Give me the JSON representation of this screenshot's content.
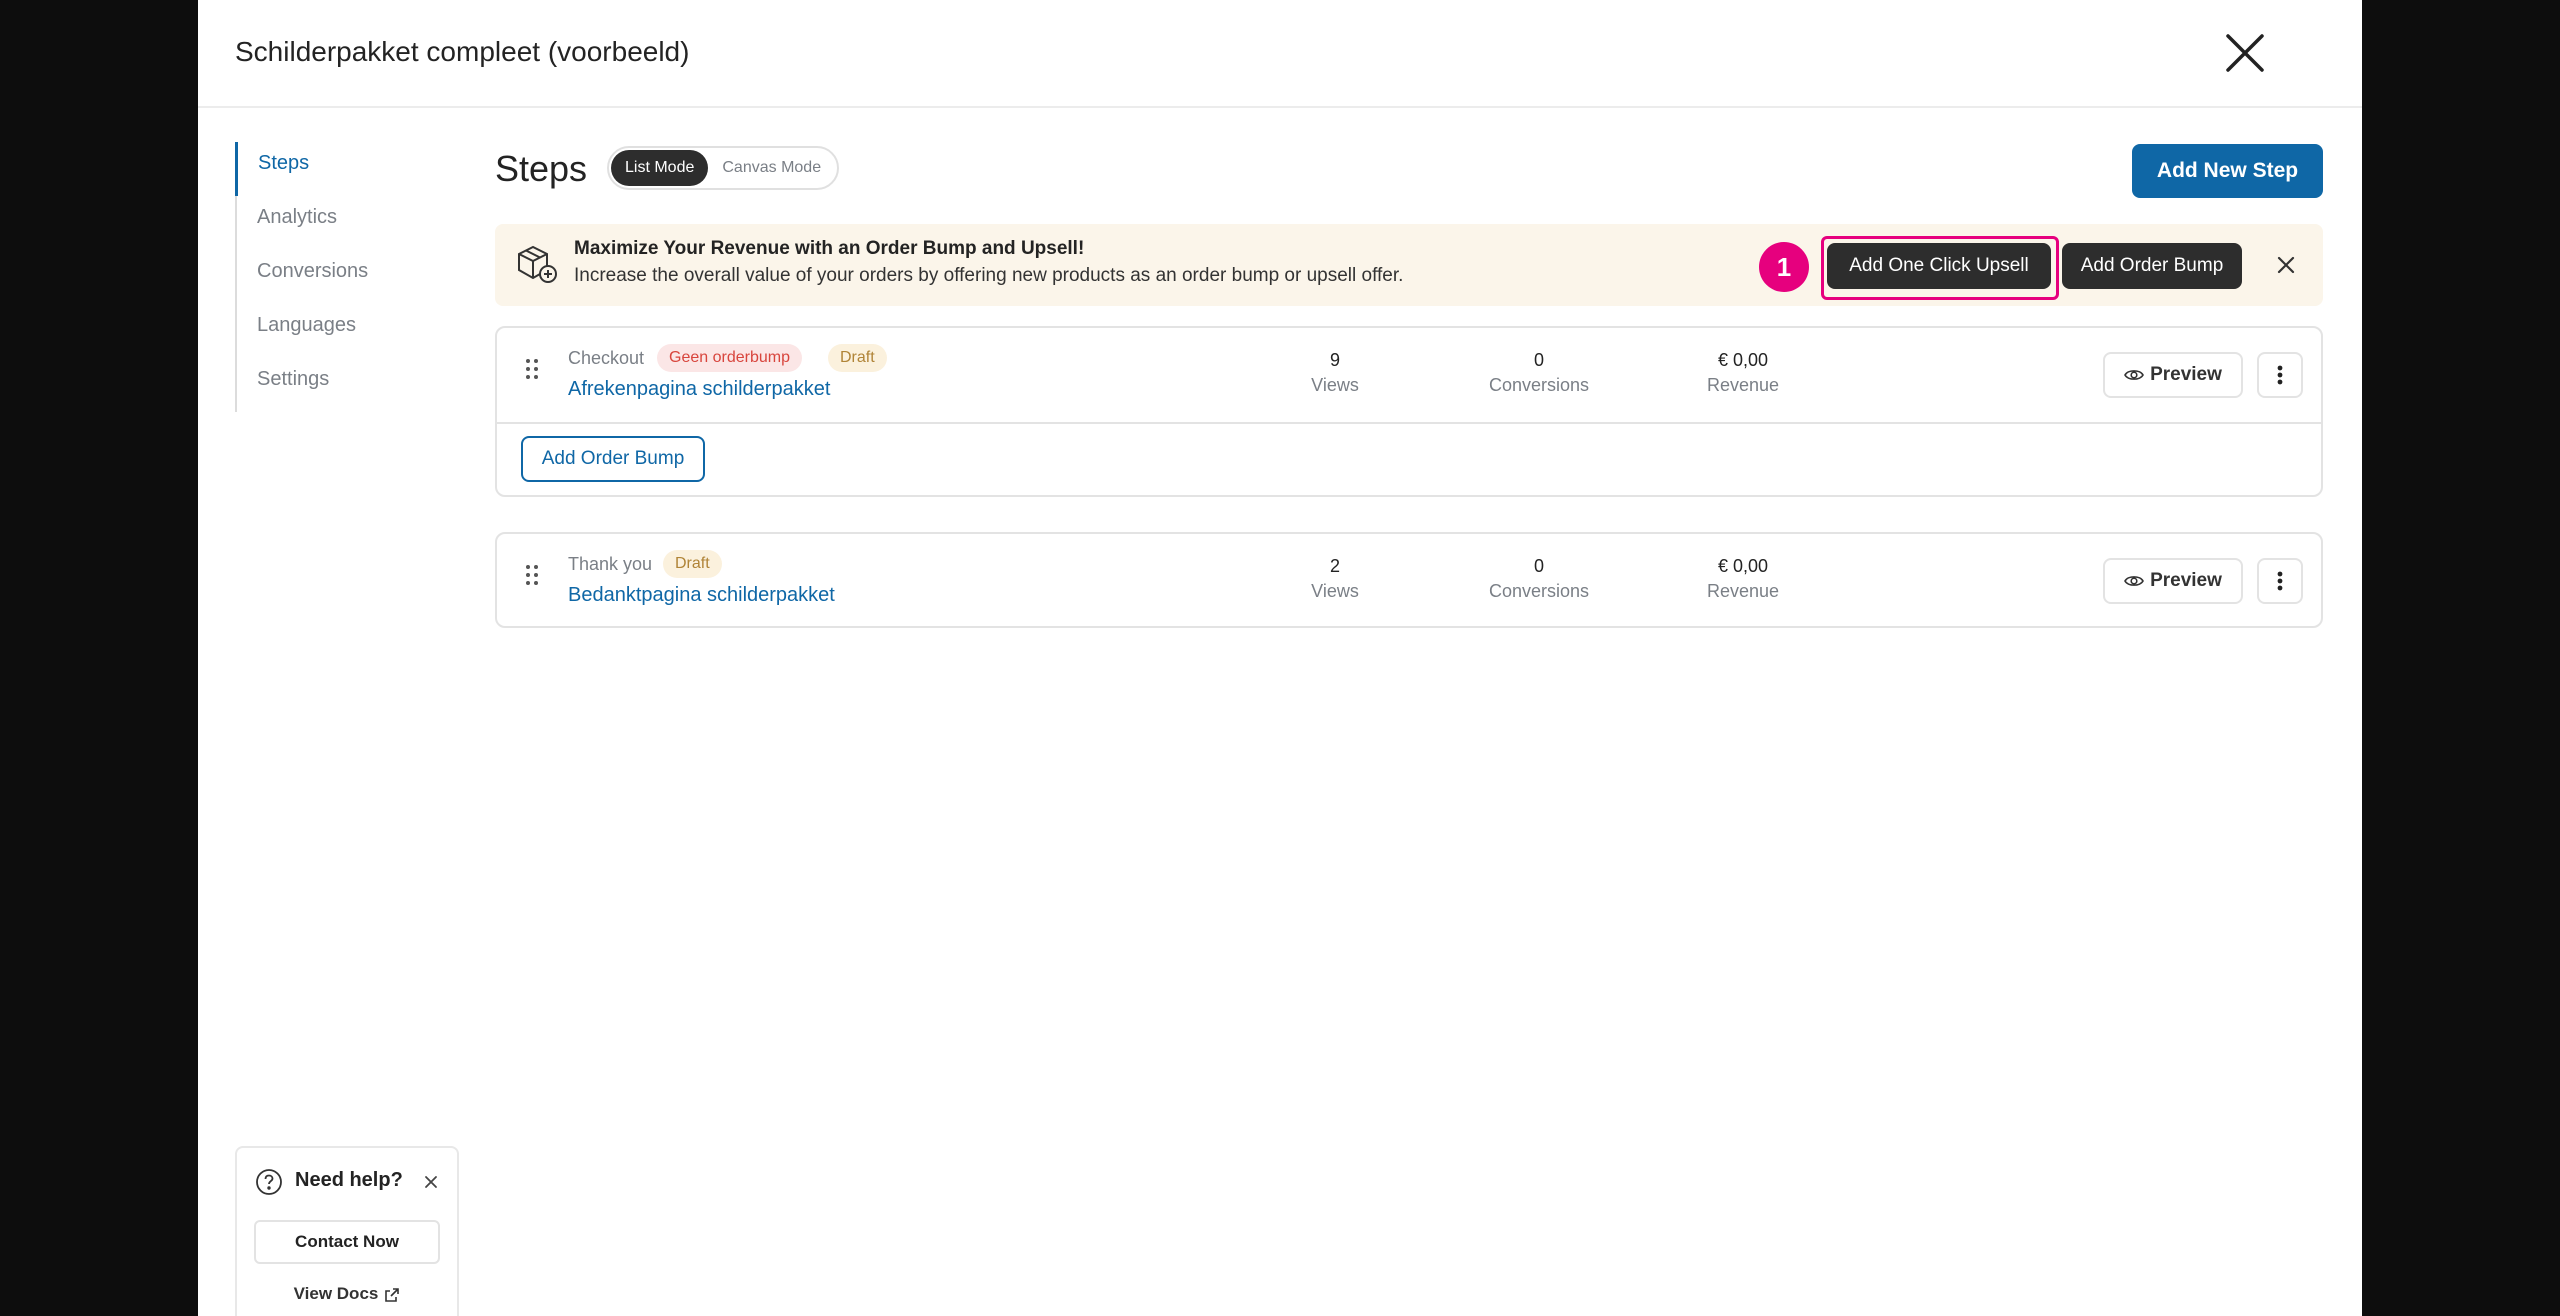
{
  "modal": {
    "title": "Schilderpakket compleet (voorbeeld)"
  },
  "sidebar": {
    "items": [
      {
        "label": "Steps"
      },
      {
        "label": "Analytics"
      },
      {
        "label": "Conversions"
      },
      {
        "label": "Languages"
      },
      {
        "label": "Settings"
      }
    ]
  },
  "main": {
    "title": "Steps",
    "modes": [
      "List Mode",
      "Canvas Mode"
    ],
    "add_step_label": "Add New Step"
  },
  "banner": {
    "title": "Maximize Your Revenue with an Order Bump and Upsell!",
    "description": "Increase the overall value of your orders by offering new products as an order bump or upsell offer.",
    "step_number": "1",
    "upsell_label": "Add One Click Upsell",
    "order_bump_label": "Add Order Bump"
  },
  "steps": [
    {
      "type": "Checkout",
      "badges": [
        "Geen orderbump",
        "Draft"
      ],
      "name": "Afrekenpagina schilderpakket",
      "views": "9",
      "views_label": "Views",
      "conversions": "0",
      "conversions_label": "Conversions",
      "revenue": "€ 0,00",
      "revenue_label": "Revenue",
      "preview_label": "Preview",
      "add_order_bump_label": "Add Order Bump"
    },
    {
      "type": "Thank you",
      "badges": [
        "Draft"
      ],
      "name": "Bedanktpagina schilderpakket",
      "views": "2",
      "views_label": "Views",
      "conversions": "0",
      "conversions_label": "Conversions",
      "revenue": "€ 0,00",
      "revenue_label": "Revenue",
      "preview_label": "Preview"
    }
  ],
  "help": {
    "title": "Need help?",
    "contact_label": "Contact Now",
    "docs_label": "View Docs"
  },
  "colors": {
    "accent": "#0f67a6",
    "highlight": "#e6007e",
    "banner_bg": "#fbf5ea",
    "dark_button": "#2d2d2d"
  }
}
